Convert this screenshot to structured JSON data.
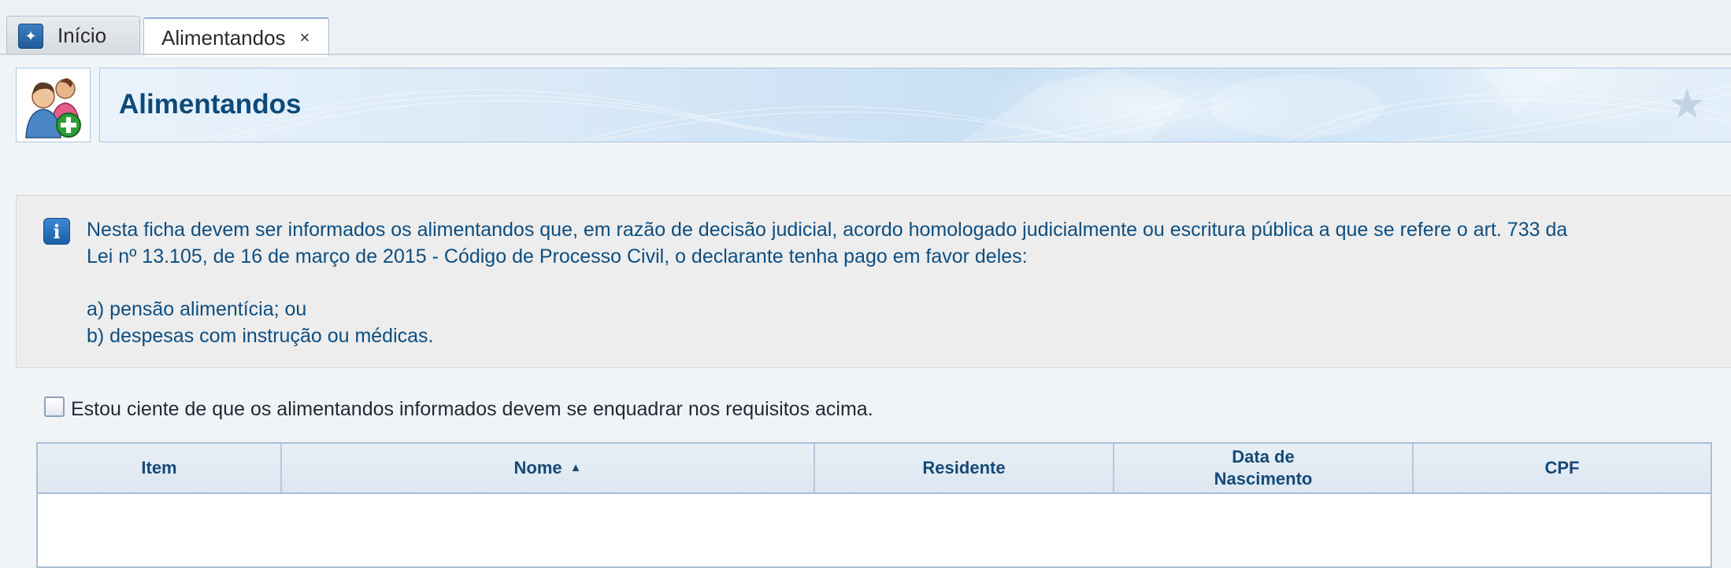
{
  "tabs": [
    {
      "label": "Início",
      "icon": "home-shield-icon",
      "active": false
    },
    {
      "label": "Alimentandos",
      "active": true,
      "close_icon": "close-icon"
    }
  ],
  "header": {
    "title": "Alimentandos",
    "icon": "add-dependents-icon",
    "favorite_icon": "star-icon"
  },
  "info": {
    "icon": "info-icon",
    "lines": [
      "Nesta ficha devem ser informados os alimentandos que, em razão de decisão judicial, acordo homologado judicialmente ou escritura pública a que se refere o art. 733 da",
      "Lei nº 13.105, de 16 de março de 2015 - Código de Processo Civil, o declarante tenha pago em favor deles:",
      "a) pensão alimentícia; ou",
      "b) despesas com instrução ou médicas."
    ]
  },
  "acknowledgement": {
    "label": "Estou ciente de que os alimentandos informados devem se enquadrar nos requisitos acima.",
    "checked": false
  },
  "table": {
    "columns": [
      {
        "label": "Item"
      },
      {
        "label": "Nome",
        "sorted": "ascending"
      },
      {
        "label": "Residente"
      },
      {
        "label_line1": "Data de",
        "label_line2": "Nascimento"
      },
      {
        "label": "CPF"
      }
    ],
    "rows": []
  },
  "colors": {
    "title": "#0c4a7a",
    "info_text": "#0d4e80",
    "table_border": "#a8bfd6"
  }
}
